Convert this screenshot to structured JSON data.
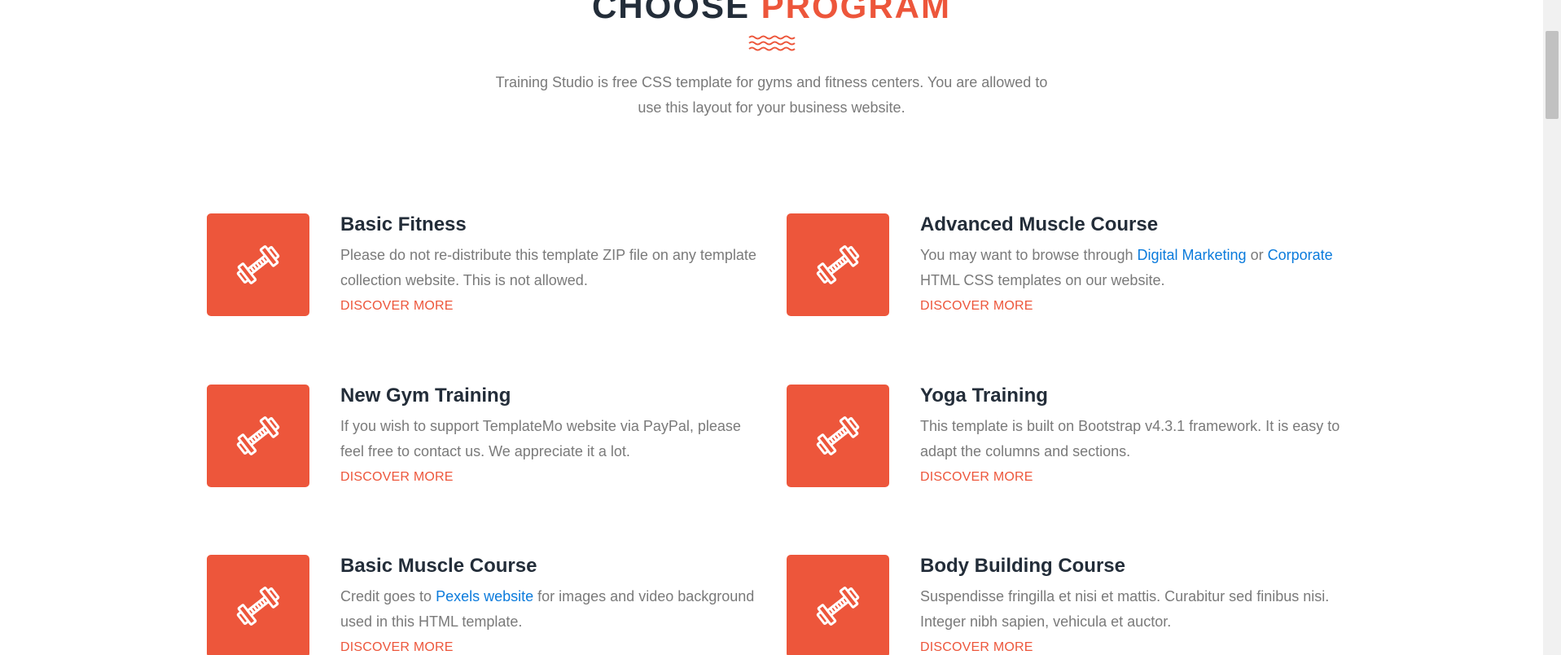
{
  "heading": {
    "title_part1": "CHOOSE ",
    "title_part2": "PROGRAM",
    "description": "Training Studio is free CSS template for gyms and fitness centers. You are allowed to use this layout for your business website."
  },
  "colors": {
    "accent": "#ed563b",
    "heading": "#232d39",
    "body_text": "#7a7a7a",
    "link": "#0b7bdc"
  },
  "programs": [
    {
      "title": "Basic Fitness",
      "desc": "Please do not re-distribute this template ZIP file on any template collection website. This is not allowed.",
      "more": "DISCOVER MORE",
      "icon": "dumbbell-icon"
    },
    {
      "title": "Advanced Muscle Course",
      "desc_pre": "You may want to browse through ",
      "link1": "Digital Marketing",
      "desc_mid": " or ",
      "link2": "Corporate",
      "desc_post": " HTML CSS templates on our website.",
      "more": "DISCOVER MORE",
      "icon": "dumbbell-icon"
    },
    {
      "title": "New Gym Training",
      "desc": "If you wish to support TemplateMo website via PayPal, please feel free to contact us. We appreciate it a lot.",
      "more": "DISCOVER MORE",
      "icon": "dumbbell-icon"
    },
    {
      "title": "Yoga Training",
      "desc": "This template is built on Bootstrap v4.3.1 framework. It is easy to adapt the columns and sections.",
      "more": "DISCOVER MORE",
      "icon": "dumbbell-icon"
    },
    {
      "title": "Basic Muscle Course",
      "desc_pre": "Credit goes to ",
      "link1": "Pexels website",
      "desc_post": " for images and video background used in this HTML template.",
      "more": "DISCOVER MORE",
      "icon": "dumbbell-icon"
    },
    {
      "title": "Body Building Course",
      "desc": "Suspendisse fringilla et nisi et mattis. Curabitur sed finibus nisi. Integer nibh sapien, vehicula et auctor.",
      "more": "DISCOVER MORE",
      "icon": "dumbbell-icon"
    }
  ]
}
